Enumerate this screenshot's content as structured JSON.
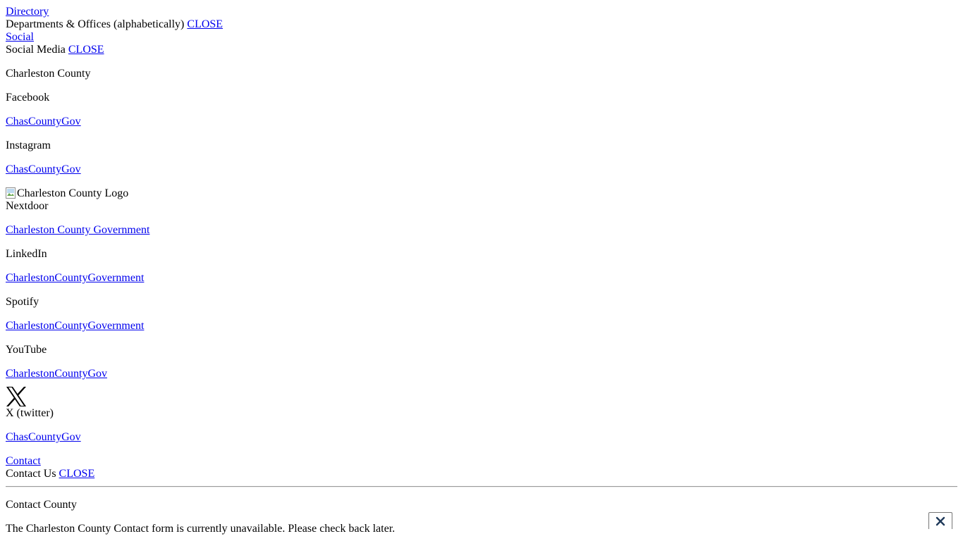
{
  "directory": {
    "link": "Directory",
    "heading": "Departments & Offices (alphabetically)",
    "close": "CLOSE"
  },
  "social": {
    "link": "Social",
    "heading": "Social Media",
    "close": "CLOSE",
    "org": "Charleston County",
    "logo_alt": "Charleston County Logo",
    "platforms": [
      {
        "name": "Facebook",
        "handle": "ChasCountyGov"
      },
      {
        "name": "Instagram",
        "handle": "ChasCountyGov"
      },
      {
        "name": "Nextdoor",
        "handle": "Charleston County Government"
      },
      {
        "name": "LinkedIn",
        "handle": "CharlestonCountyGovernment"
      },
      {
        "name": "Spotify",
        "handle": "CharlestonCountyGovernment"
      },
      {
        "name": "YouTube",
        "handle": "CharlestonCountyGov"
      },
      {
        "name": "X (twitter)",
        "handle": "ChasCountyGov",
        "icon": "x-logo-icon"
      }
    ]
  },
  "contact": {
    "link": "Contact",
    "heading": "Contact Us",
    "close": "CLOSE",
    "title": "Contact County",
    "message": "The Charleston County Contact form is currently unavailable. Please check back later.",
    "close_icon": "close-icon"
  }
}
